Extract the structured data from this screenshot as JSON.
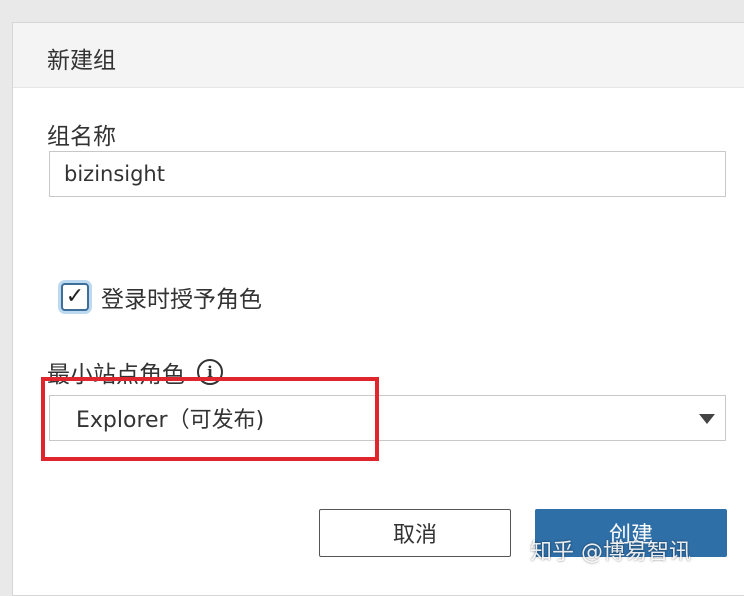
{
  "dialog": {
    "title": "新建组",
    "group_name_label": "组名称",
    "group_name_value": "bizinsight",
    "grant_role_checkbox": {
      "checked": true,
      "label": "登录时授予角色",
      "check_glyph": "✓"
    },
    "min_site_role_label": "最小站点角色",
    "info_icon_glyph": "i",
    "min_site_role_value": "Explorer（可发布)",
    "cancel_label": "取消",
    "create_label": "创建"
  },
  "watermark": "知乎 @博易智讯",
  "colors": {
    "primary_button": "#2f6fa8",
    "highlight_border": "#e0252c",
    "checkbox_focus": "#bcd9f0"
  }
}
